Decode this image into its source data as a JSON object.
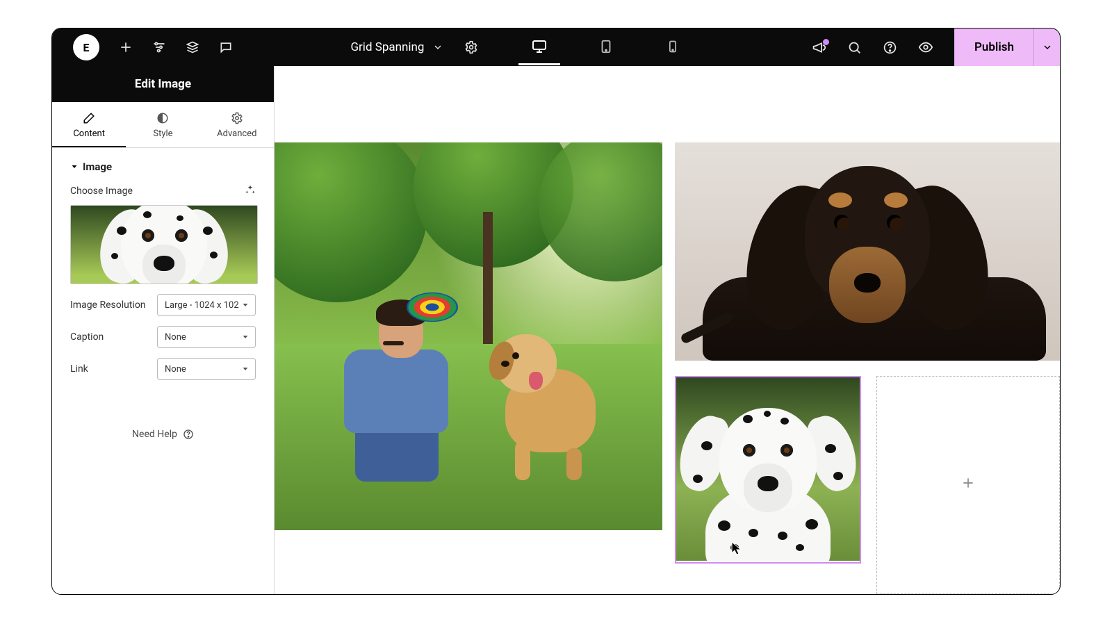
{
  "topbar": {
    "logo_text": "E",
    "doc_name": "Grid Spanning",
    "publish_label": "Publish"
  },
  "panel": {
    "title": "Edit Image",
    "tabs": {
      "content": "Content",
      "style": "Style",
      "advanced": "Advanced"
    },
    "section_title": "Image",
    "choose_label": "Choose Image",
    "resolution_label": "Image Resolution",
    "resolution_value": "Large - 1024 x 102",
    "caption_label": "Caption",
    "caption_value": "None",
    "link_label": "Link",
    "link_value": "None",
    "help_label": "Need Help"
  },
  "canvas": {
    "add_label": "+"
  }
}
